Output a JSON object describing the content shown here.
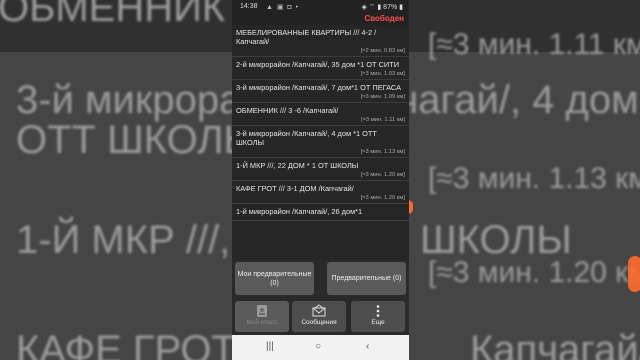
{
  "background": {
    "line1": "ОБМЕННИК /// 3",
    "line1_right": "[≈3 мин. 1.11 км]",
    "line2": "3-й микрорайон /Капчагай/, 4 дом *1",
    "line3": "ОТТ ШКОЛЫ",
    "line3_right": "[≈3 мин. 1.13 км]",
    "line4": "1-Й МКР ///, 22",
    "line4_right": "ШКОЛЫ",
    "line5_right": "[≈3 мин. 1.20 км]",
    "line6": "КАФЕ ГРОТ",
    "line6_right": "Капчагай/"
  },
  "status_bar": {
    "time": "14:38",
    "icons": "▲ ▣ ◘ •",
    "right": "◈ ⌔ ▮ 87% ▮"
  },
  "app_status": {
    "label": "Свободен"
  },
  "orders": [
    {
      "address": "МЕБЕЛИРОВАННЫЕ КВАРТИРЫ /// 4-2 /Капчагай/",
      "distance": "[≈2 мин. 0.83 км]"
    },
    {
      "address": "2-й микрорайон /Капчагай/, 35 дом *1 ОТ СИТИ",
      "distance": "[≈3 мин. 1.03 км]"
    },
    {
      "address": "3-й микрорайон /Капчагай/, 7 дом*1 ОТ ПЕГАСА",
      "distance": "[≈3 мин. 1.09 км]"
    },
    {
      "address": "ОБМЕННИК /// 3 -6 /Капчагай/",
      "distance": "[≈3 мин. 1.11 км]"
    },
    {
      "address": "3-й микрорайон /Капчагай/, 4 дом *1 ОТТ ШКОЛЫ",
      "distance": "[≈3 мин. 1.13 км]"
    },
    {
      "address": "1-Й МКР ///, 22 ДОМ * 1 ОТ ШКОЛЫ",
      "distance": "[≈3 мин. 1.20 км]"
    },
    {
      "address": "КАФЕ ГРОТ /// 3-1 ДОМ /Капчагай/",
      "distance": "[≈3 мин. 1.20 км]"
    },
    {
      "address": "1-й микрорайон /Капчагай/, 26 дом*1",
      "distance": ""
    }
  ],
  "buttons": {
    "my_preliminary": "Мои предварительные (0)",
    "preliminary": "Предварительные (0)",
    "my_profile": "Мой класс",
    "messages": "Сообщения",
    "more": "Еще"
  },
  "navbar": {
    "recent": "|||",
    "home": "○",
    "back": "‹"
  },
  "colors": {
    "accent_red": "#ff4d4d",
    "orange": "#ff6a2e"
  }
}
